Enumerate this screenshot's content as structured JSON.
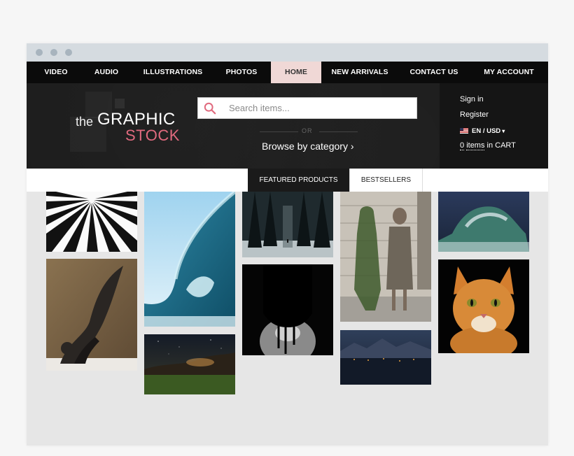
{
  "nav": {
    "items": [
      "VIDEO",
      "AUDIO",
      "ILLUSTRATIONS",
      "PHOTOS",
      "HOME",
      "NEW ARRIVALS",
      "CONTACT US",
      "MY ACCOUNT"
    ],
    "active": "HOME"
  },
  "logo": {
    "the": "the",
    "graphic": "GRAPHIC",
    "stock": "STOCK"
  },
  "search": {
    "placeholder": "Search items..."
  },
  "divider": {
    "or": "OR"
  },
  "browse": {
    "label": "Browse by category ›"
  },
  "account": {
    "sign_in": "Sign in",
    "register": "Register",
    "language": "EN / USD",
    "cart_count": "0",
    "cart_items": "items",
    "cart_label": "in CART"
  },
  "tabs": [
    "FEATURED PRODUCTS",
    "BESTSELLERS"
  ],
  "colors": {
    "accent": "#e06a7e",
    "nav_bg": "#0b0b0b",
    "active_nav": "#f0d8d6",
    "header_bg": "#1c1c1c"
  }
}
